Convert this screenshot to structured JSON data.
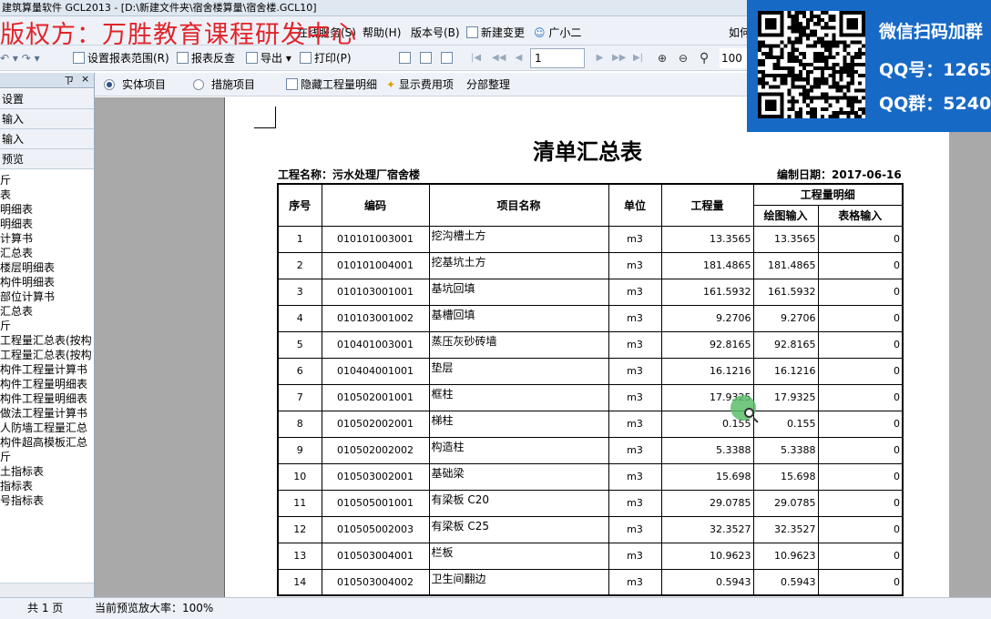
{
  "titlebar": {
    "text": "建筑算量软件 GCL2013 - [D:\\新建文件夹\\宿舍楼算量\\宿舍楼.GCL10]"
  },
  "watermark": {
    "text": "版权方：万胜教育课程研发中心"
  },
  "menu": {
    "service": "在线服务(S)",
    "help": "帮助(H)",
    "version": "版本号(B)",
    "newchange": "新建变更",
    "assistant": "广小二",
    "howto": "如何"
  },
  "toolbar": {
    "set_range": "设置报表范围(R)",
    "check": "报表反查",
    "export": "导出",
    "print": "打印(P)",
    "page_value": "1",
    "zoom_value": "100"
  },
  "options": {
    "entity": "实体项目",
    "measure": "措施项目",
    "hide_detail": "隐藏工程量明细",
    "show_cost": "显示费用项",
    "part_arrange": "分部整理"
  },
  "sidebar": {
    "pin": "ㄗ",
    "close": "×",
    "buttons": [
      "设置",
      "输入",
      "输入",
      "预览"
    ],
    "tree": [
      "斤",
      "表",
      "明细表",
      "明细表",
      "计算书",
      "汇总表",
      "楼层明细表",
      "构件明细表",
      "部位计算书",
      "汇总表",
      "斤",
      "工程量汇总表(按构",
      "工程量汇总表(按构",
      "构件工程量计算书",
      "构件工程量明细表",
      "构件工程量明细表",
      "做法工程量计算书",
      "人防墙工程量汇总",
      "构件超高模板汇总",
      "斤",
      "土指标表",
      "指标表",
      "号指标表"
    ]
  },
  "report": {
    "title": "清单汇总表",
    "project": "工程名称：污水处理厂宿舍楼",
    "date": "编制日期：2017-06-16",
    "headers": {
      "seq": "序号",
      "code": "编码",
      "name": "项目名称",
      "unit": "单位",
      "qty": "工程量",
      "detail": "工程量明细",
      "draw": "绘图输入",
      "table": "表格输入"
    },
    "rows": [
      {
        "seq": "1",
        "code": "010101003001",
        "name": "挖沟槽土方",
        "unit": "m3",
        "qty": "13.3565",
        "draw": "13.3565",
        "table": "0"
      },
      {
        "seq": "2",
        "code": "010101004001",
        "name": "挖基坑土方",
        "unit": "m3",
        "qty": "181.4865",
        "draw": "181.4865",
        "table": "0"
      },
      {
        "seq": "3",
        "code": "010103001001",
        "name": "基坑回填",
        "unit": "m3",
        "qty": "161.5932",
        "draw": "161.5932",
        "table": "0"
      },
      {
        "seq": "4",
        "code": "010103001002",
        "name": "基槽回填",
        "unit": "m3",
        "qty": "9.2706",
        "draw": "9.2706",
        "table": "0"
      },
      {
        "seq": "5",
        "code": "010401003001",
        "name": "蒸压灰砂砖墙",
        "unit": "m3",
        "qty": "92.8165",
        "draw": "92.8165",
        "table": "0"
      },
      {
        "seq": "6",
        "code": "010404001001",
        "name": "垫层",
        "unit": "m3",
        "qty": "16.1216",
        "draw": "16.1216",
        "table": "0"
      },
      {
        "seq": "7",
        "code": "010502001001",
        "name": "框柱",
        "unit": "m3",
        "qty": "17.9325",
        "draw": "17.9325",
        "table": "0"
      },
      {
        "seq": "8",
        "code": "010502002001",
        "name": "梯柱",
        "unit": "m3",
        "qty": "0.155",
        "draw": "0.155",
        "table": "0"
      },
      {
        "seq": "9",
        "code": "010502002002",
        "name": "构造柱",
        "unit": "m3",
        "qty": "5.3388",
        "draw": "5.3388",
        "table": "0"
      },
      {
        "seq": "10",
        "code": "010503002001",
        "name": "基础梁",
        "unit": "m3",
        "qty": "15.698",
        "draw": "15.698",
        "table": "0"
      },
      {
        "seq": "11",
        "code": "010505001001",
        "name": "有梁板 C20",
        "unit": "m3",
        "qty": "29.0785",
        "draw": "29.0785",
        "table": "0"
      },
      {
        "seq": "12",
        "code": "010505002003",
        "name": "有梁板 C25",
        "unit": "m3",
        "qty": "32.3527",
        "draw": "32.3527",
        "table": "0"
      },
      {
        "seq": "13",
        "code": "010503004001",
        "name": "栏板",
        "unit": "m3",
        "qty": "10.9623",
        "draw": "10.9623",
        "table": "0"
      },
      {
        "seq": "14",
        "code": "010503004002",
        "name": "卫生间翻边",
        "unit": "m3",
        "qty": "0.5943",
        "draw": "0.5943",
        "table": "0"
      }
    ]
  },
  "status": {
    "pages": "共 1 页",
    "zoom": "当前预览放大率：100%"
  },
  "overlay": {
    "line1": "微信扫码加群",
    "line2": "QQ号：1265",
    "line3": "QQ群：5240"
  }
}
